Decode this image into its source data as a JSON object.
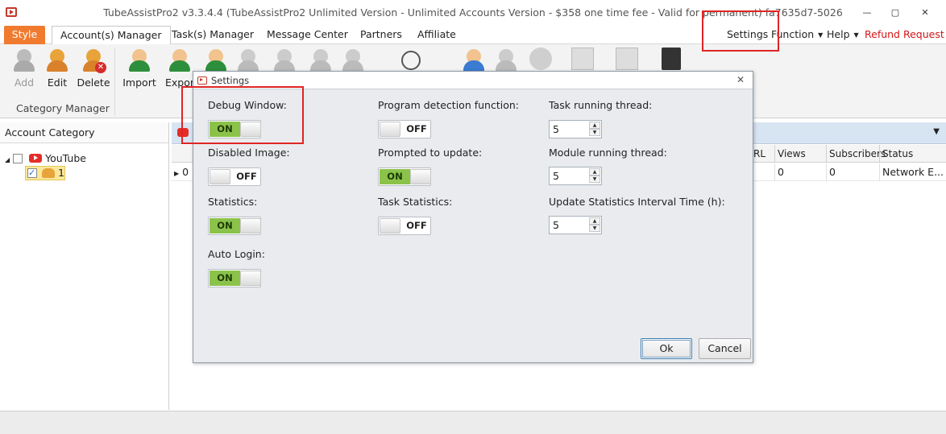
{
  "window": {
    "title": "TubeAssistPro2 v3.3.4.4 (TubeAssistPro2 Unlimited Version - Unlimited Accounts Version - $358 one time fee - Valid for permanent) fa7635d7-5026",
    "minimize": "—",
    "maximize": "▢",
    "close": "✕"
  },
  "menu": {
    "tabs": [
      "Style",
      "Account(s) Manager",
      "Task(s) Manager",
      "Message Center",
      "Partners",
      "Affiliate"
    ],
    "right": {
      "settings": "Settings",
      "function": "Function",
      "help": "Help",
      "refund": "Refund Request"
    }
  },
  "ribbon": {
    "add": "Add",
    "edit": "Edit",
    "delete": "Delete",
    "import": "Import",
    "export": "Expor",
    "group_label": "Category Manager"
  },
  "left_panel": {
    "header": "Account Category",
    "root": "YouTube",
    "child_count": "1"
  },
  "grid": {
    "columns": [
      "RL",
      "Views",
      "Subscribers",
      "Status"
    ],
    "row": {
      "index": "0",
      "views": "0",
      "subscribers": "0",
      "status": "Network E..."
    }
  },
  "dialog": {
    "title": "Settings",
    "options": {
      "debug_window": {
        "label": "Debug Window:",
        "state": "ON"
      },
      "disabled_image": {
        "label": "Disabled Image:",
        "state": "OFF"
      },
      "statistics": {
        "label": "Statistics:",
        "state": "ON"
      },
      "auto_login": {
        "label": "Auto Login:",
        "state": "ON"
      },
      "program_detection": {
        "label": "Program detection function:",
        "state": "OFF"
      },
      "prompted_update": {
        "label": "Prompted to update:",
        "state": "ON"
      },
      "task_statistics": {
        "label": "Task Statistics:",
        "state": "OFF"
      }
    },
    "spinners": {
      "task_thread": {
        "label": "Task running thread:",
        "value": "5"
      },
      "module_thread": {
        "label": "Module running thread:",
        "value": "5"
      },
      "update_interval": {
        "label": "Update Statistics Interval Time (h):",
        "value": "5"
      }
    },
    "ok": "Ok",
    "cancel": "Cancel"
  },
  "colors": {
    "style_tab": "#f07b2f",
    "toggle_on": "#8bc34a",
    "highlight_box": "#e02424",
    "refund": "#d01616"
  }
}
